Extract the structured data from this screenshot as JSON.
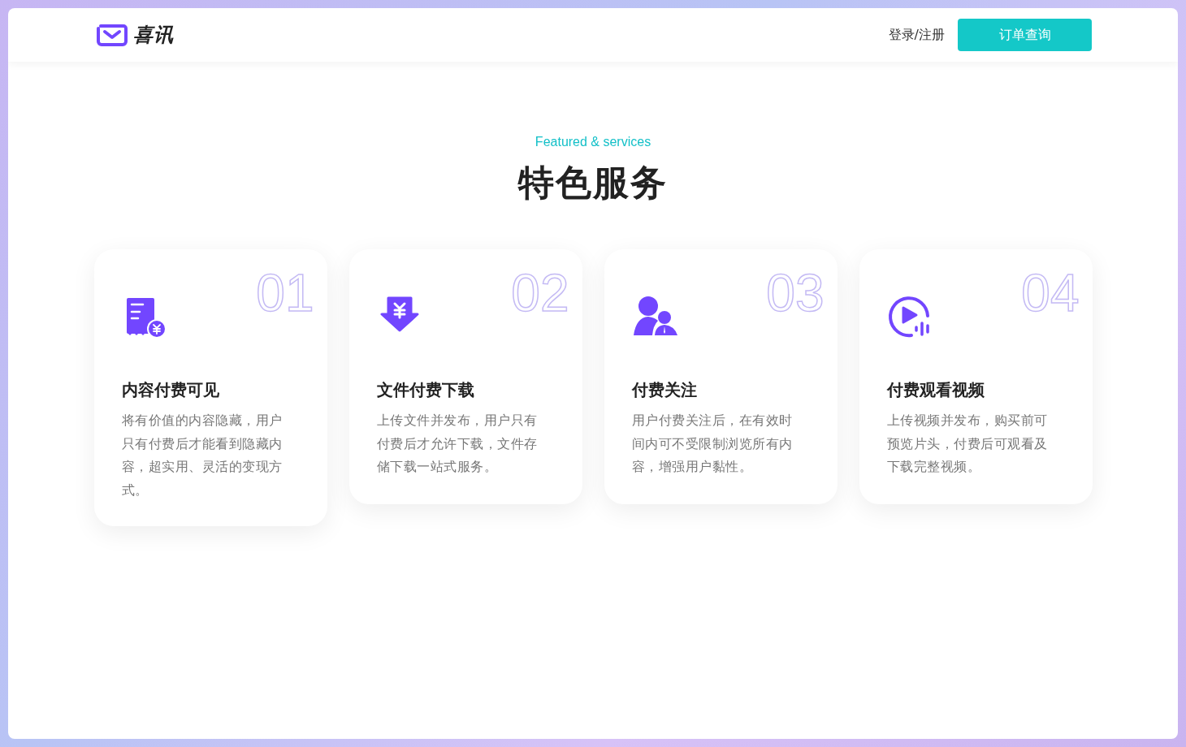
{
  "header": {
    "brand": "喜讯",
    "login": "登录/注册",
    "order_button": "订单查询"
  },
  "section": {
    "subtitle": "Featured & services",
    "title": "特色服务"
  },
  "cards": [
    {
      "kind": "receipt",
      "number": "01",
      "title": "内容付费可见",
      "text": "将有价值的内容隐藏，用户只有付费后才能看到隐藏内容，超实用、灵活的变现方式。"
    },
    {
      "kind": "download",
      "number": "02",
      "title": "文件付费下载",
      "text": "上传文件并发布，用户只有付费后才允许下载，文件存储下载一站式服务。"
    },
    {
      "kind": "users",
      "number": "03",
      "title": "付费关注",
      "text": "用户付费关注后，在有效时间内可不受限制浏览所有内容，增强用户黏性。"
    },
    {
      "kind": "video",
      "number": "04",
      "title": "付费观看视频",
      "text": "上传视频并发布，购买前可预览片头，付费后可观看及下载完整视频。"
    }
  ]
}
